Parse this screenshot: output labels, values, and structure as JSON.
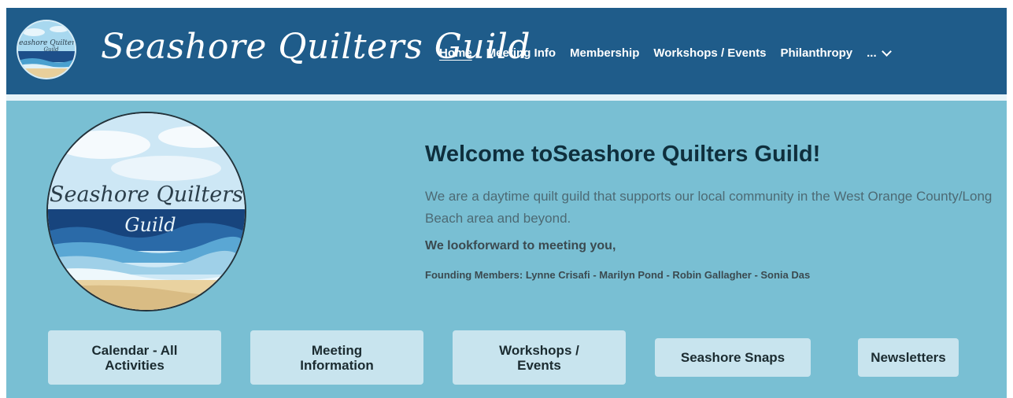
{
  "header": {
    "brand": "Seashore Quilters Guild",
    "nav": [
      {
        "label": "Home",
        "active": true
      },
      {
        "label": "Meeting Info",
        "active": false
      },
      {
        "label": "Membership",
        "active": false
      },
      {
        "label": "Workshops / Events",
        "active": false
      },
      {
        "label": "Philanthropy",
        "active": false
      }
    ],
    "more_label": "..."
  },
  "hero": {
    "logo_text_line1": "Seashore Quilters",
    "logo_text_line2": "Guild",
    "title": "Welcome toSeashore Quilters Guild!",
    "intro": "We are a daytime quilt guild that supports our local community in the West Orange County/Long Beach area and beyond.",
    "closing": "We lookforward to meeting you,",
    "founders": "Founding Members: Lynne Crisafi - Marilyn Pond - Robin Gallagher - Sonia Das"
  },
  "buttons": [
    {
      "label": "Calendar - All Activities"
    },
    {
      "label": "Meeting Information"
    },
    {
      "label": "Workshops / Events"
    },
    {
      "label": "Seashore Snaps"
    },
    {
      "label": "Newsletters"
    }
  ],
  "colors": {
    "header_bg": "#1f5c8a",
    "hero_bg": "#79bfd3",
    "button_bg": "#c8e4ee"
  }
}
